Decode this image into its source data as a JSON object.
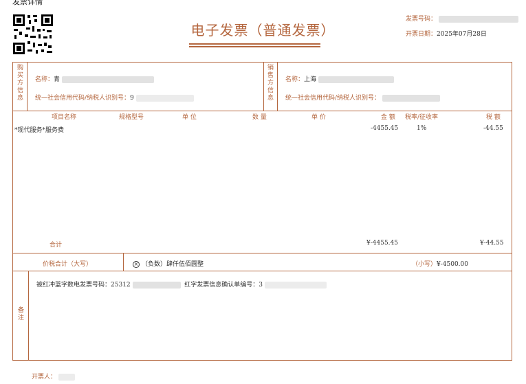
{
  "page_top_text": "发票详情",
  "title": "电子发票（普通发票）",
  "header": {
    "invoice_no_label": "发票号码：",
    "issue_date_label": "开票日期：",
    "issue_date": "2025年07月28日"
  },
  "buyer": {
    "side_label": "购买方信息",
    "name_label": "名称：",
    "name_value": "青",
    "tax_label": "统一社会信用代码/纳税人识别号：",
    "tax_value": "9"
  },
  "seller": {
    "side_label": "销售方信息",
    "name_label": "名称：",
    "name_value": "上海",
    "tax_label": "统一社会信用代码/纳税人识别号："
  },
  "columns": [
    "项目名称",
    "规格型号",
    "单 位",
    "数 量",
    "单 价",
    "金 额",
    "税率/征收率",
    "税 额"
  ],
  "items": [
    {
      "name": "*现代服务*服务费",
      "amount": "-4455.45",
      "rate": "1%",
      "tax": "-44.55"
    }
  ],
  "totals": {
    "label": "合计",
    "amount": "¥-4455.45",
    "tax": "¥-44.55"
  },
  "total_in_words": {
    "label": "价税合计（大写）",
    "words": "（负数）肆仟伍佰圆整",
    "small_label": "（小写）",
    "small_value": "¥-4500.00"
  },
  "remarks": {
    "side_label": "备注",
    "line_label_1": "被红冲蓝字数电发票号码：",
    "line_value_1": "25312",
    "line_label_2": "红字发票信息确认单编号：",
    "line_value_2": "3"
  },
  "issuer": {
    "label": "开票人："
  },
  "colors": {
    "accent": "#b4663e",
    "text": "#333333"
  }
}
